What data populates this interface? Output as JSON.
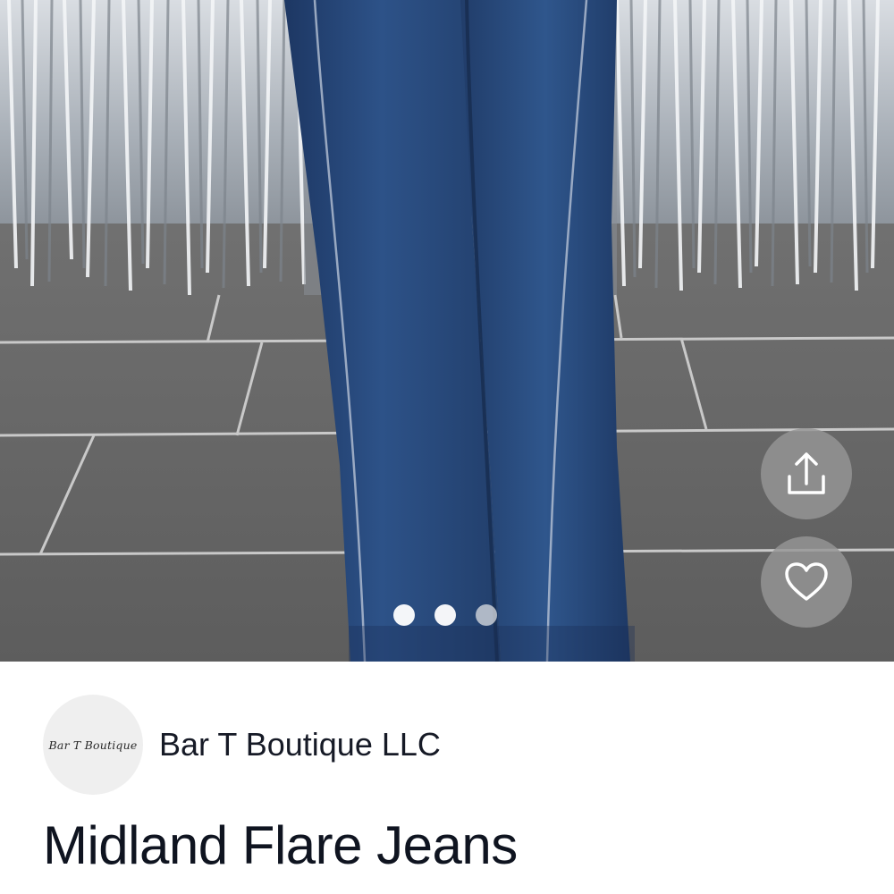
{
  "listing": {
    "title": "Midland Flare Jeans"
  },
  "seller": {
    "name": "Bar T Boutique LLC",
    "logo_text": "Bar T Boutique"
  },
  "gallery": {
    "image_count": 3,
    "active_index": 0
  },
  "actions": {
    "share_icon": "share-icon",
    "favorite_icon": "heart-icon"
  },
  "colors": {
    "text_primary": "#0f1420",
    "action_button_bg": "#969696",
    "denim": "#27497c"
  }
}
